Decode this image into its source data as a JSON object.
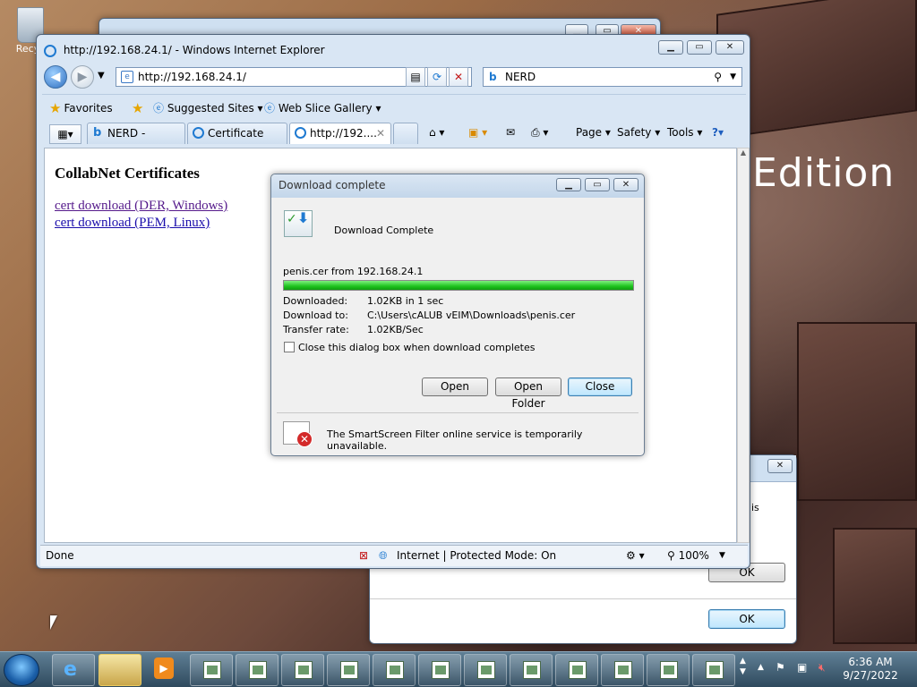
{
  "desktop": {
    "recycle_label": "Recyc",
    "wallpaper_text": "Edition"
  },
  "ie": {
    "title": "http://192.168.24.1/ - Windows Internet Explorer",
    "address": "http://192.168.24.1/",
    "search_text": "NERD",
    "favorites_label": "Favorites",
    "suggested_sites": "Suggested Sites ▾",
    "web_slice": "Web Slice Gallery ▾",
    "tabs": [
      "NERD - Search",
      "Certificate Err...",
      "http://192...."
    ],
    "commands": {
      "page": "Page ▾",
      "safety": "Safety ▾",
      "tools": "Tools ▾",
      "help": "?▾"
    },
    "page": {
      "heading": "CollabNet Certificates",
      "link1": "cert download (DER, Windows)",
      "link2": "cert download (PEM, Linux)"
    },
    "status": {
      "left": "Done",
      "zone": "Internet | Protected Mode: On",
      "zoom": "100%"
    }
  },
  "download": {
    "title": "Download complete",
    "heading": "Download Complete",
    "file_from": "penis.cer from 192.168.24.1",
    "progress_fraction": 1.0,
    "downloaded_label": "Downloaded:",
    "downloaded_value": "1.02KB in 1 sec",
    "to_label": "Download to:",
    "to_value": "C:\\Users\\cALUB vEIM\\Downloads\\penis.cer",
    "rate_label": "Transfer rate:",
    "rate_value": "1.02KB/Sec",
    "checkbox_label": "Close this dialog box when download completes",
    "btn_open": "Open",
    "btn_open_folder": "Open Folder",
    "btn_close": "Close",
    "smartscreen": "The SmartScreen Filter online service is temporarily unavailable."
  },
  "msg_window": {
    "partial_text": "is",
    "ok1": "OK",
    "ok2": "OK"
  },
  "taskbar": {
    "time": "6:36 AM",
    "date": "9/27/2022"
  },
  "colors": {
    "progress": "#1ec31e",
    "link": "#1a0dab",
    "visited": "#551a8b"
  }
}
